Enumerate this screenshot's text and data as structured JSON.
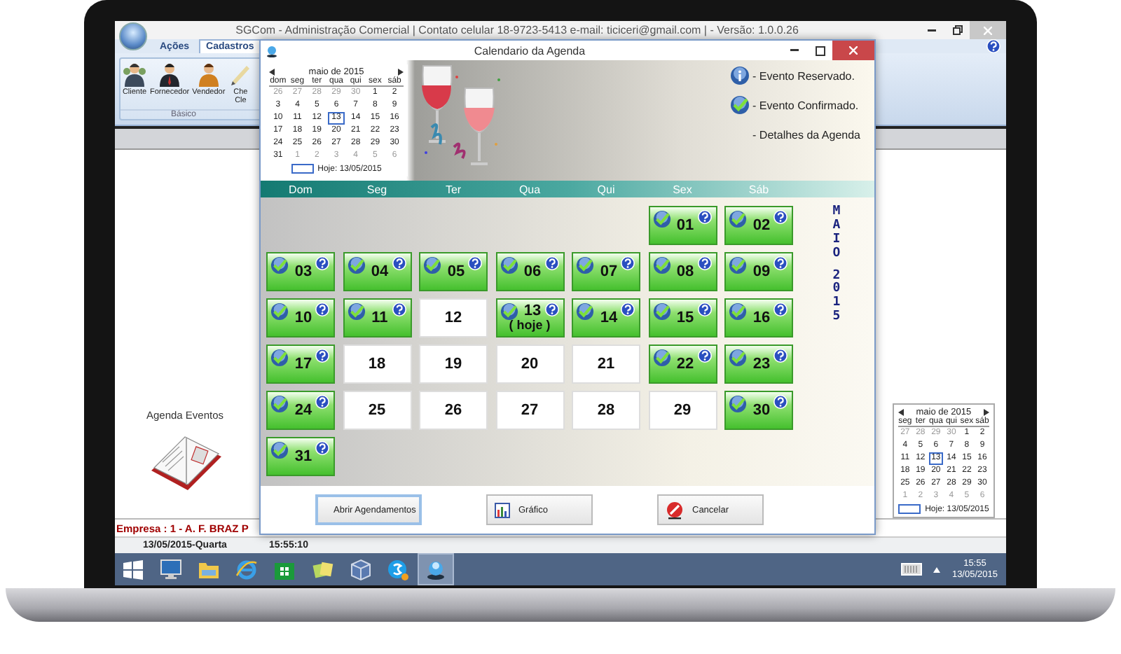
{
  "window": {
    "title": "SGCom - Administração Comercial | Contato celular 18-9723-5413 e-mail: ticiceri@gmail.com | - Versão: 1.0.0.26"
  },
  "ribbon": {
    "tabs": [
      {
        "label": "Ações",
        "selected": false
      },
      {
        "label": "Cadastros",
        "selected": true
      }
    ],
    "items": [
      {
        "kind": "client",
        "label": "Cliente"
      },
      {
        "kind": "supplier",
        "label": "Fornecedor"
      },
      {
        "kind": "seller",
        "label": "Vendedor"
      },
      {
        "kind": "check",
        "label": "Che Cle"
      }
    ],
    "group": "Básico"
  },
  "agenda_shortcut": {
    "label": "Agenda Eventos"
  },
  "side_calendar": {
    "month": "maio de 2015",
    "weekdays": [
      "seg",
      "ter",
      "qua",
      "qui",
      "sex",
      "sáb"
    ],
    "weeks": [
      [
        {
          "d": "27",
          "muted": true,
          "selected": false
        },
        {
          "d": "28",
          "muted": true,
          "selected": false
        },
        {
          "d": "29",
          "muted": true,
          "selected": false
        },
        {
          "d": "30",
          "muted": true,
          "selected": false
        },
        {
          "d": "1",
          "muted": false,
          "selected": false
        },
        {
          "d": "2",
          "muted": false,
          "selected": false
        }
      ],
      [
        {
          "d": "4",
          "muted": false,
          "selected": false
        },
        {
          "d": "5",
          "muted": false,
          "selected": false
        },
        {
          "d": "6",
          "muted": false,
          "selected": false
        },
        {
          "d": "7",
          "muted": false,
          "selected": false
        },
        {
          "d": "8",
          "muted": false,
          "selected": false
        },
        {
          "d": "9",
          "muted": false,
          "selected": false
        }
      ],
      [
        {
          "d": "11",
          "muted": false,
          "selected": false
        },
        {
          "d": "12",
          "muted": false,
          "selected": false
        },
        {
          "d": "13",
          "muted": false,
          "selected": true
        },
        {
          "d": "14",
          "muted": false,
          "selected": false
        },
        {
          "d": "15",
          "muted": false,
          "selected": false
        },
        {
          "d": "16",
          "muted": false,
          "selected": false
        }
      ],
      [
        {
          "d": "18",
          "muted": false,
          "selected": false
        },
        {
          "d": "19",
          "muted": false,
          "selected": false
        },
        {
          "d": "20",
          "muted": false,
          "selected": false
        },
        {
          "d": "21",
          "muted": false,
          "selected": false
        },
        {
          "d": "22",
          "muted": false,
          "selected": false
        },
        {
          "d": "23",
          "muted": false,
          "selected": false
        }
      ],
      [
        {
          "d": "25",
          "muted": false,
          "selected": false
        },
        {
          "d": "26",
          "muted": false,
          "selected": false
        },
        {
          "d": "27",
          "muted": false,
          "selected": false
        },
        {
          "d": "28",
          "muted": false,
          "selected": false
        },
        {
          "d": "29",
          "muted": false,
          "selected": false
        },
        {
          "d": "30",
          "muted": false,
          "selected": false
        }
      ],
      [
        {
          "d": "1",
          "muted": true,
          "selected": false
        },
        {
          "d": "2",
          "muted": true,
          "selected": false
        },
        {
          "d": "3",
          "muted": true,
          "selected": false
        },
        {
          "d": "4",
          "muted": true,
          "selected": false
        },
        {
          "d": "5",
          "muted": true,
          "selected": false
        },
        {
          "d": "6",
          "muted": true,
          "selected": false
        }
      ]
    ],
    "today": "Hoje: 13/05/2015"
  },
  "status_bar": {
    "company": "Empresa : 1 - A. F. BRAZ P",
    "date": "13/05/2015-Quarta",
    "time": "15:55:10"
  },
  "taskbar": {
    "apps": [
      {
        "kind": "windows",
        "selected": false
      },
      {
        "kind": "monitor",
        "selected": false
      },
      {
        "kind": "folder",
        "selected": false
      },
      {
        "kind": "browser",
        "selected": false
      },
      {
        "kind": "store",
        "selected": false
      },
      {
        "kind": "notes",
        "selected": false
      },
      {
        "kind": "cube",
        "selected": false
      },
      {
        "kind": "chat",
        "selected": false
      },
      {
        "kind": "app",
        "selected": true
      }
    ],
    "clock_time": "15:55",
    "clock_date": "13/05/2015"
  },
  "dialog": {
    "title": "Calendario da Agenda",
    "calendar": {
      "month": "maio de 2015",
      "weekdays": [
        "dom",
        "seg",
        "ter",
        "qua",
        "qui",
        "sex",
        "sáb"
      ],
      "weeks": [
        [
          {
            "d": "26",
            "muted": true,
            "selected": false
          },
          {
            "d": "27",
            "muted": true,
            "selected": false
          },
          {
            "d": "28",
            "muted": true,
            "selected": false
          },
          {
            "d": "29",
            "muted": true,
            "selected": false
          },
          {
            "d": "30",
            "muted": true,
            "selected": false
          },
          {
            "d": "1",
            "muted": false,
            "selected": false
          },
          {
            "d": "2",
            "muted": false,
            "selected": false
          }
        ],
        [
          {
            "d": "3",
            "muted": false,
            "selected": false
          },
          {
            "d": "4",
            "muted": false,
            "selected": false
          },
          {
            "d": "5",
            "muted": false,
            "selected": false
          },
          {
            "d": "6",
            "muted": false,
            "selected": false
          },
          {
            "d": "7",
            "muted": false,
            "selected": false
          },
          {
            "d": "8",
            "muted": false,
            "selected": false
          },
          {
            "d": "9",
            "muted": false,
            "selected": false
          }
        ],
        [
          {
            "d": "10",
            "muted": false,
            "selected": false
          },
          {
            "d": "11",
            "muted": false,
            "selected": false
          },
          {
            "d": "12",
            "muted": false,
            "selected": false
          },
          {
            "d": "13",
            "muted": false,
            "selected": true
          },
          {
            "d": "14",
            "muted": false,
            "selected": false
          },
          {
            "d": "15",
            "muted": false,
            "selected": false
          },
          {
            "d": "16",
            "muted": false,
            "selected": false
          }
        ],
        [
          {
            "d": "17",
            "muted": false,
            "selected": false
          },
          {
            "d": "18",
            "muted": false,
            "selected": false
          },
          {
            "d": "19",
            "muted": false,
            "selected": false
          },
          {
            "d": "20",
            "muted": false,
            "selected": false
          },
          {
            "d": "21",
            "muted": false,
            "selected": false
          },
          {
            "d": "22",
            "muted": false,
            "selected": false
          },
          {
            "d": "23",
            "muted": false,
            "selected": false
          }
        ],
        [
          {
            "d": "24",
            "muted": false,
            "selected": false
          },
          {
            "d": "25",
            "muted": false,
            "selected": false
          },
          {
            "d": "26",
            "muted": false,
            "selected": false
          },
          {
            "d": "27",
            "muted": false,
            "selected": false
          },
          {
            "d": "28",
            "muted": false,
            "selected": false
          },
          {
            "d": "29",
            "muted": false,
            "selected": false
          },
          {
            "d": "30",
            "muted": false,
            "selected": false
          }
        ],
        [
          {
            "d": "31",
            "muted": false,
            "selected": false
          },
          {
            "d": "1",
            "muted": true,
            "selected": false
          },
          {
            "d": "2",
            "muted": true,
            "selected": false
          },
          {
            "d": "3",
            "muted": true,
            "selected": false
          },
          {
            "d": "4",
            "muted": true,
            "selected": false
          },
          {
            "d": "5",
            "muted": true,
            "selected": false
          },
          {
            "d": "6",
            "muted": true,
            "selected": false
          }
        ]
      ],
      "today": "Hoje: 13/05/2015"
    },
    "legend": [
      {
        "kind": "reserved",
        "label": "- Evento Reservado."
      },
      {
        "kind": "confirmed",
        "label": "- Evento Confirmado."
      },
      {
        "kind": "details",
        "label": "- Detalhes da Agenda"
      }
    ],
    "weekdays": [
      "Dom",
      "Seg",
      "Ter",
      "Qua",
      "Qui",
      "Sex",
      "Sáb"
    ],
    "days": [
      {
        "kind": "blank"
      },
      {
        "kind": "blank"
      },
      {
        "kind": "blank"
      },
      {
        "kind": "blank"
      },
      {
        "kind": "blank"
      },
      {
        "kind": "event",
        "day": "01"
      },
      {
        "kind": "event",
        "day": "02"
      },
      {
        "kind": "event",
        "day": "03"
      },
      {
        "kind": "event",
        "day": "04"
      },
      {
        "kind": "event",
        "day": "05"
      },
      {
        "kind": "event",
        "day": "06"
      },
      {
        "kind": "event",
        "day": "07"
      },
      {
        "kind": "event",
        "day": "08"
      },
      {
        "kind": "event",
        "day": "09"
      },
      {
        "kind": "event",
        "day": "10"
      },
      {
        "kind": "event",
        "day": "11"
      },
      {
        "kind": "free",
        "day": "12"
      },
      {
        "kind": "event",
        "day": "13",
        "note": "( hoje )"
      },
      {
        "kind": "event",
        "day": "14"
      },
      {
        "kind": "event",
        "day": "15"
      },
      {
        "kind": "event",
        "day": "16"
      },
      {
        "kind": "event",
        "day": "17"
      },
      {
        "kind": "free",
        "day": "18"
      },
      {
        "kind": "free",
        "day": "19"
      },
      {
        "kind": "free",
        "day": "20"
      },
      {
        "kind": "free",
        "day": "21"
      },
      {
        "kind": "event",
        "day": "22"
      },
      {
        "kind": "event",
        "day": "23"
      },
      {
        "kind": "event",
        "day": "24"
      },
      {
        "kind": "free",
        "day": "25"
      },
      {
        "kind": "free",
        "day": "26"
      },
      {
        "kind": "free",
        "day": "27"
      },
      {
        "kind": "free",
        "day": "28"
      },
      {
        "kind": "free",
        "day": "29"
      },
      {
        "kind": "event",
        "day": "30"
      },
      {
        "kind": "event",
        "day": "31"
      }
    ],
    "month": "MAIO",
    "year": "2015",
    "buttons": [
      {
        "kind": "open",
        "label": "Abrir Agendamentos",
        "focused": true
      },
      {
        "kind": "chart",
        "label": "Gráfico",
        "focused": false
      },
      {
        "kind": "cancel",
        "label": "Cancelar",
        "focused": false
      }
    ]
  }
}
